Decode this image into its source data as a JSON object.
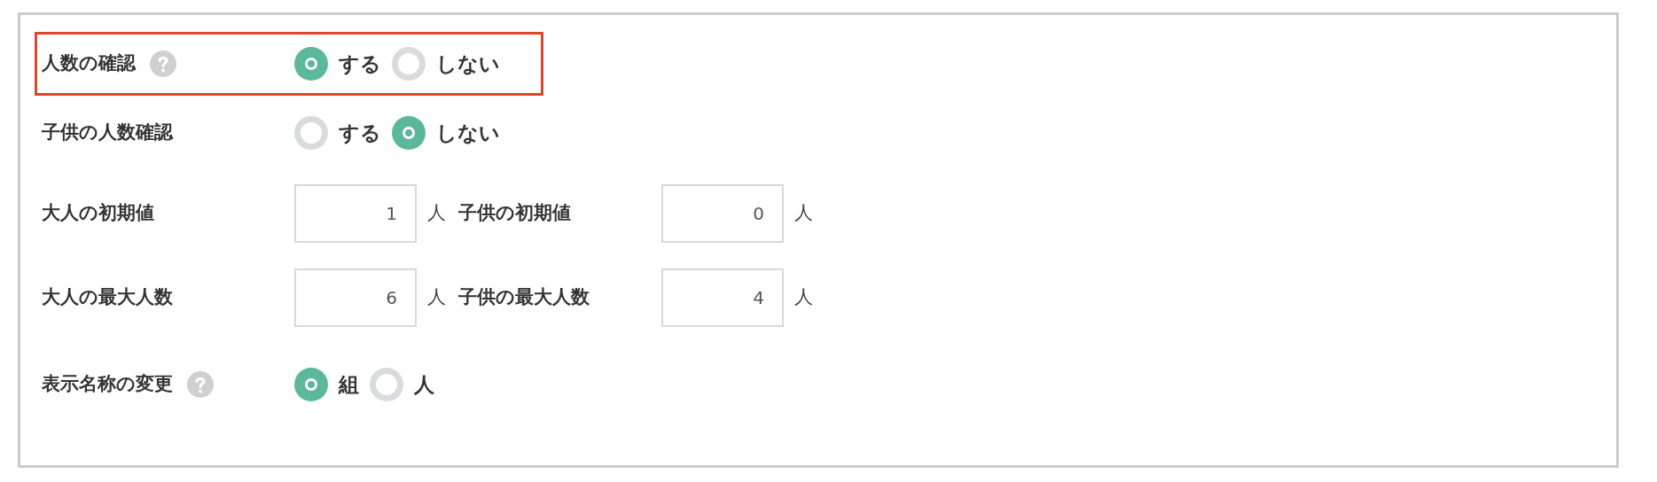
{
  "rows": [
    {
      "kind": "radio",
      "label": "人数の確認",
      "help": true,
      "highlighted": true,
      "options": [
        {
          "label": "する",
          "selected": true
        },
        {
          "label": "しない",
          "selected": false
        }
      ]
    },
    {
      "kind": "radio",
      "label": "子供の人数確認",
      "help": false,
      "highlighted": false,
      "options": [
        {
          "label": "する",
          "selected": false
        },
        {
          "label": "しない",
          "selected": true
        }
      ]
    },
    {
      "kind": "numbers",
      "fields": [
        {
          "label": "大人の初期値",
          "value": "1",
          "unit": "人"
        },
        {
          "label": "子供の初期値",
          "value": "0",
          "unit": "人"
        }
      ]
    },
    {
      "kind": "numbers",
      "fields": [
        {
          "label": "大人の最大人数",
          "value": "6",
          "unit": "人"
        },
        {
          "label": "子供の最大人数",
          "value": "4",
          "unit": "人"
        }
      ]
    },
    {
      "kind": "radio",
      "label": "表示名称の変更",
      "help": true,
      "highlighted": false,
      "options": [
        {
          "label": "組",
          "selected": true
        },
        {
          "label": "人",
          "selected": false
        }
      ]
    }
  ]
}
